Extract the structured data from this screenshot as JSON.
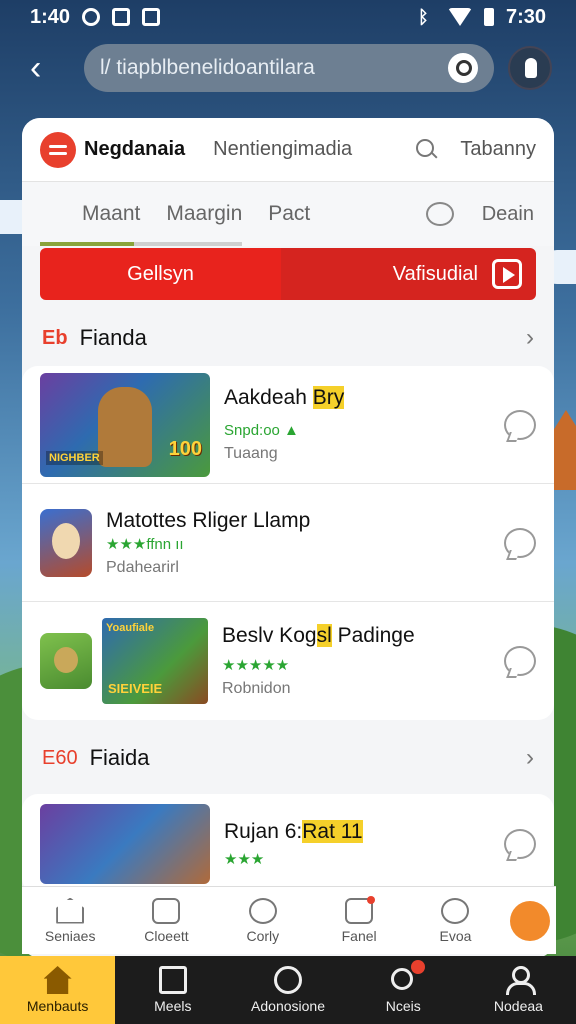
{
  "status_bar": {
    "time_left": "1:40",
    "time_right": "7:30"
  },
  "top_bar": {
    "url": "l/ tiapblbenelidoantilara"
  },
  "app_header": {
    "name": "Negdanaia",
    "tab2": "Nentiengimadia",
    "tab3": "Tabanny"
  },
  "tabs": {
    "items": [
      "Maant",
      "Maargin",
      "Pact"
    ],
    "last": "Deain"
  },
  "banner": {
    "left": "Gellsyn",
    "right": "Vafisudial"
  },
  "section1": {
    "tag": "Eb",
    "title": "Fianda"
  },
  "items": [
    {
      "name": "Aakdeah",
      "name_hl": "Bry",
      "meta": "Snpd:oo ▲",
      "sub": "Tuaang",
      "thumb_num": "100",
      "thumb_label": "NIGHBER"
    },
    {
      "name": "Matottes Rliger Llamp",
      "meta": "★★★ffnn ıı",
      "sub": "Pdahearirl"
    },
    {
      "name": "Beslv Kog",
      "name_hl": "sl",
      "name_tail": "Padinge",
      "meta": "★★★★★",
      "sub": "Robnidon",
      "thumb_num": "Yoaufiale",
      "thumb_label": "SIEIVEIE"
    }
  ],
  "section2": {
    "tag": "E60",
    "title": "Fiaida"
  },
  "item4": {
    "name": "Rujan 6:",
    "name_hl": "Rat 11",
    "meta": "★★★"
  },
  "inner_nav": [
    "Seniaes",
    "Cloeett",
    "Corly",
    "Fanel",
    "Evoa"
  ],
  "bottom_nav": [
    "Menbauts",
    "Meels",
    "Adonosione",
    "Nceis",
    "Nodeaa"
  ],
  "colors": {
    "accent_red": "#e8231d",
    "accent_orange": "#f28a2b",
    "active_tab": "#ffc83a",
    "rating_green": "#2aa532"
  }
}
